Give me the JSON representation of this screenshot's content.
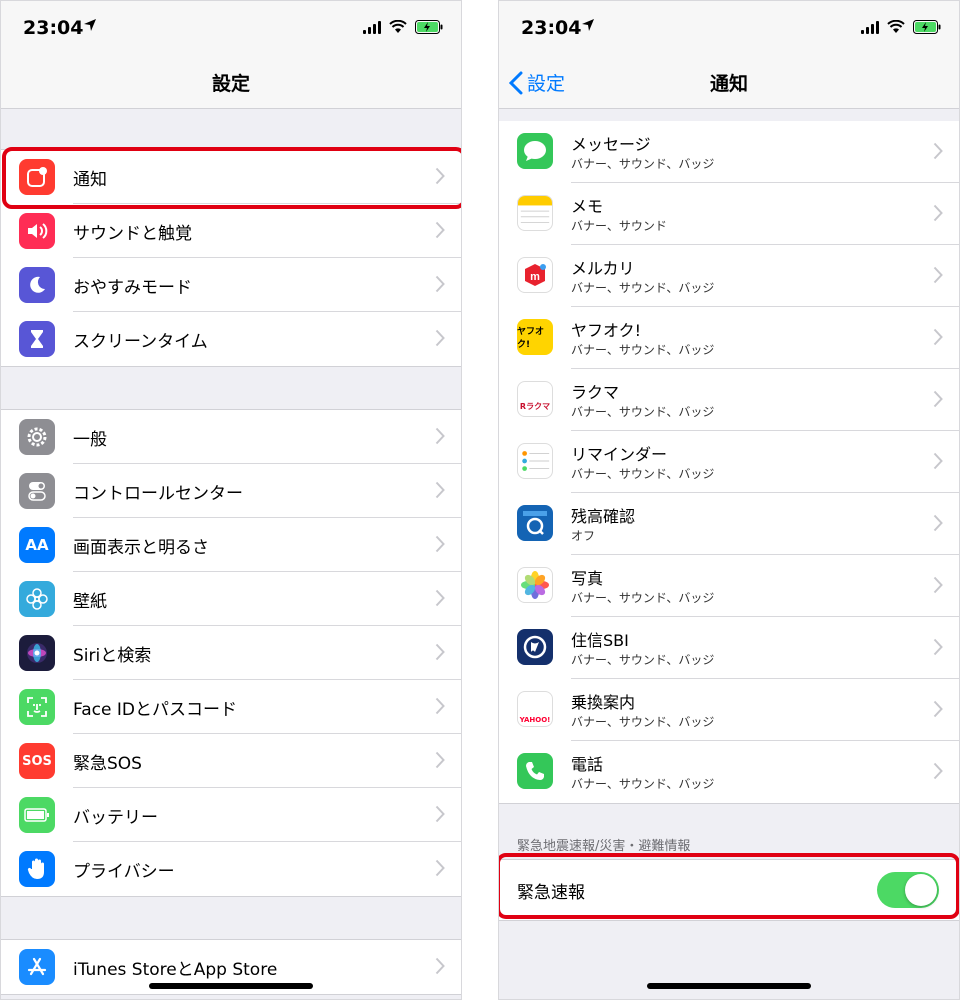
{
  "left": {
    "status": {
      "time": "23:04"
    },
    "nav": {
      "title": "設定"
    },
    "groups": [
      {
        "items": [
          {
            "label": "通知",
            "icon": "notifications-icon",
            "color": "#ff3b30"
          },
          {
            "label": "サウンドと触覚",
            "icon": "speaker-icon",
            "color": "#ff2d55"
          },
          {
            "label": "おやすみモード",
            "icon": "moon-icon",
            "color": "#5856d6"
          },
          {
            "label": "スクリーンタイム",
            "icon": "hourglass-icon",
            "color": "#5856d6"
          }
        ]
      },
      {
        "items": [
          {
            "label": "一般",
            "icon": "gear-icon",
            "color": "#8e8e93"
          },
          {
            "label": "コントロールセンター",
            "icon": "toggles-icon",
            "color": "#8e8e93"
          },
          {
            "label": "画面表示と明るさ",
            "icon": "text-size-icon",
            "icon_text": "AA",
            "color": "#007aff"
          },
          {
            "label": "壁紙",
            "icon": "flower-icon",
            "color": "#34aadc"
          },
          {
            "label": "Siriと検索",
            "icon": "siri-icon",
            "color": "#1c1c3c"
          },
          {
            "label": "Face IDとパスコード",
            "icon": "face-id-icon",
            "color": "#4cd964"
          },
          {
            "label": "緊急SOS",
            "icon": "sos-icon",
            "icon_text": "SOS",
            "color": "#ff3b30"
          },
          {
            "label": "バッテリー",
            "icon": "battery-icon",
            "color": "#4cd964"
          },
          {
            "label": "プライバシー",
            "icon": "hand-icon",
            "color": "#007aff"
          }
        ]
      },
      {
        "items": [
          {
            "label": "iTunes StoreとApp Store",
            "icon": "app-store-icon",
            "color": "#1a8cff"
          }
        ]
      }
    ]
  },
  "right": {
    "status": {
      "time": "23:04"
    },
    "nav": {
      "title": "通知",
      "back": "設定"
    },
    "apps": [
      {
        "name": "メッセージ",
        "sub": "バナー、サウンド、バッジ",
        "icon": "messages-icon"
      },
      {
        "name": "メモ",
        "sub": "バナー、サウンド",
        "icon": "notes-icon"
      },
      {
        "name": "メルカリ",
        "sub": "バナー、サウンド、バッジ",
        "icon": "mercari-icon"
      },
      {
        "name": "ヤフオク!",
        "sub": "バナー、サウンド、バッジ",
        "icon": "yahuoku-icon",
        "icon_text": "ヤフオク!"
      },
      {
        "name": "ラクマ",
        "sub": "バナー、サウンド、バッジ",
        "icon": "rakuma-icon",
        "icon_text": "Rラクマ"
      },
      {
        "name": "リマインダー",
        "sub": "バナー、サウンド、バッジ",
        "icon": "reminders-icon"
      },
      {
        "name": "残高確認",
        "sub": "オフ",
        "icon": "balance-icon"
      },
      {
        "name": "写真",
        "sub": "バナー、サウンド、バッジ",
        "icon": "photos-icon"
      },
      {
        "name": "住信SBI",
        "sub": "バナー、サウンド、バッジ",
        "icon": "sbi-icon"
      },
      {
        "name": "乗換案内",
        "sub": "バナー、サウンド、バッジ",
        "icon": "train-icon",
        "icon_text": "YAHOO!"
      },
      {
        "name": "電話",
        "sub": "バナー、サウンド、バッジ",
        "icon": "phone-icon"
      }
    ],
    "emergency": {
      "header": "緊急地震速報/災害・避難情報",
      "label": "緊急速報",
      "toggle_on": true
    }
  }
}
